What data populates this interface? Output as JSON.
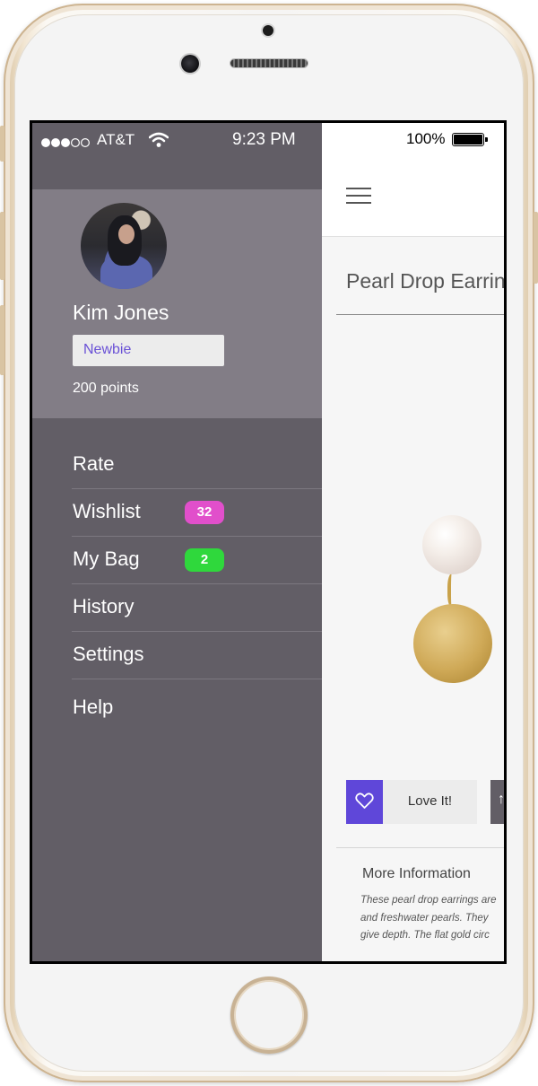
{
  "status_bar": {
    "carrier": "AT&T",
    "time": "9:23 PM",
    "battery": "100%"
  },
  "profile": {
    "name": "Kim Jones",
    "rank": "Newbie",
    "points": "200 points"
  },
  "menu": {
    "items": [
      {
        "label": "Rate"
      },
      {
        "label": "Wishlist",
        "badge": "32",
        "badge_color": "#e14fcb"
      },
      {
        "label": "My Bag",
        "badge": "2",
        "badge_color": "#2fd83c"
      },
      {
        "label": "History"
      },
      {
        "label": "Settings"
      },
      {
        "label": "Help"
      }
    ]
  },
  "product": {
    "title": "Pearl Drop Earrin",
    "love_label": "Love It!",
    "more_info_heading": "More Information",
    "description_lines": [
      "These pearl drop earrings are",
      "and freshwater pearls. They",
      "give depth. The flat gold circ"
    ]
  },
  "colors": {
    "drawer": "#625e66",
    "profile_panel": "#827d86",
    "accent": "#5f47d9"
  }
}
